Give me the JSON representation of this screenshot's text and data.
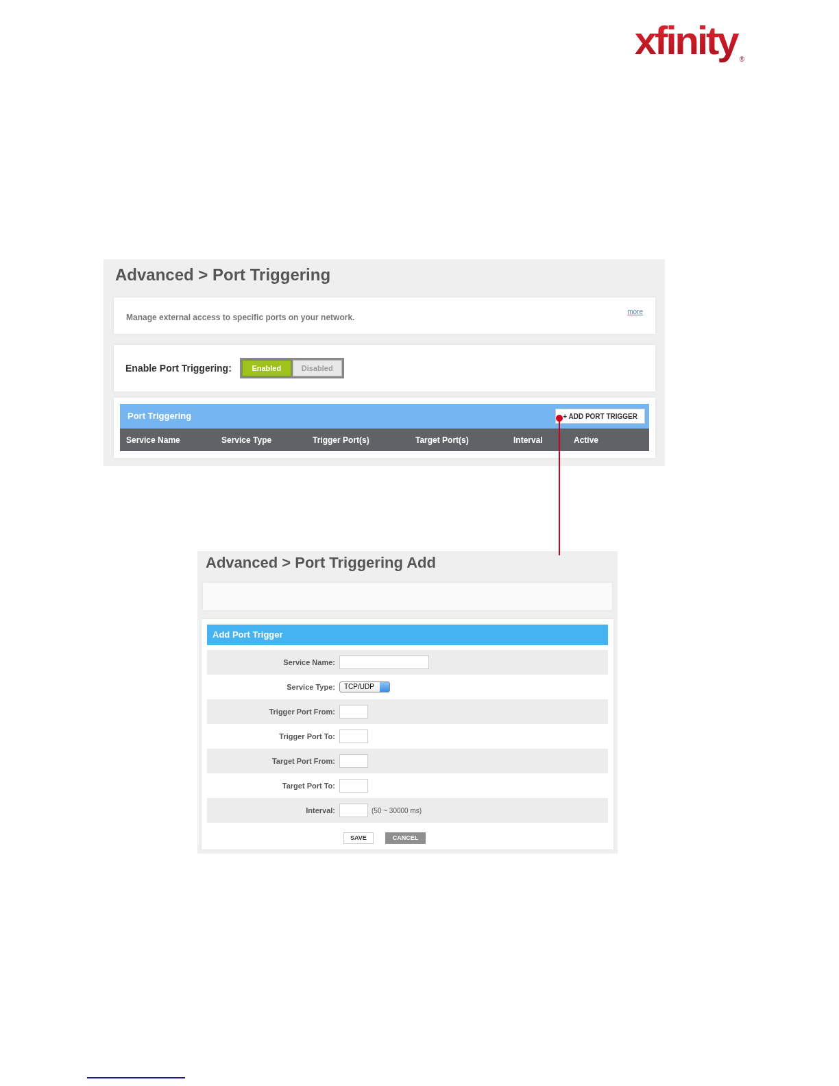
{
  "logo": {
    "text": "xfinity",
    "registered": "®"
  },
  "main_page": {
    "title": "Advanced > Port Triggering",
    "description": "Manage external access to specific ports on your network.",
    "more_link": "more",
    "enable": {
      "label": "Enable Port Triggering:",
      "options": [
        {
          "label": "Enabled",
          "selected": true
        },
        {
          "label": "Disabled",
          "selected": false
        }
      ]
    },
    "table": {
      "title": "Port Triggering",
      "add_button": "+ ADD PORT TRIGGER",
      "columns": [
        "Service Name",
        "Service Type",
        "Trigger Port(s)",
        "Target Port(s)",
        "Interval",
        "Active"
      ]
    }
  },
  "add_page": {
    "title": "Advanced > Port Triggering Add",
    "form_title": "Add Port Trigger",
    "fields": [
      {
        "label": "Service Name:",
        "kind": "wide"
      },
      {
        "label": "Service Type:",
        "kind": "select",
        "value": "TCP/UDP"
      },
      {
        "label": "Trigger Port From:",
        "kind": "short"
      },
      {
        "label": "Trigger Port To:",
        "kind": "short"
      },
      {
        "label": "Target Port From:",
        "kind": "short"
      },
      {
        "label": "Target Port To:",
        "kind": "short"
      },
      {
        "label": "Interval:",
        "kind": "short",
        "hint": "(50 ~ 30000 ms)"
      }
    ],
    "buttons": [
      {
        "label": "SAVE",
        "kind": "plain"
      },
      {
        "label": "CANCEL",
        "kind": "muted"
      }
    ]
  }
}
